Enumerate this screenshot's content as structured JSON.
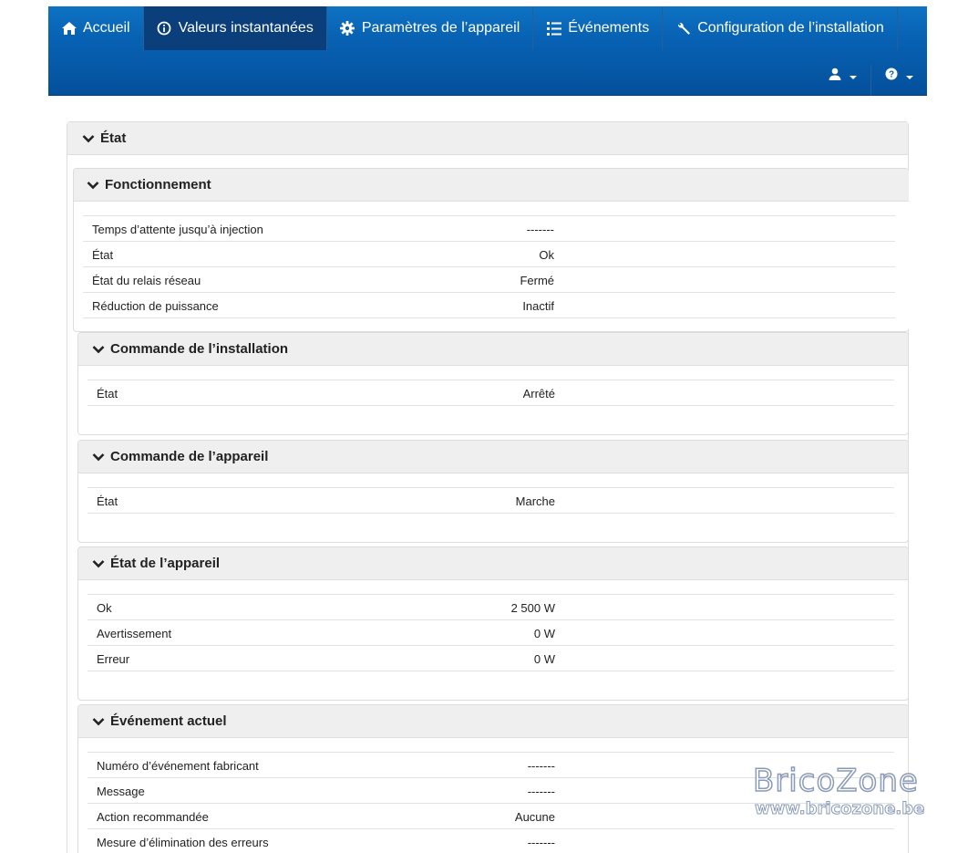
{
  "nav": {
    "items": [
      {
        "label": "Accueil",
        "icon": "home-icon"
      },
      {
        "label": "Valeurs instantanées",
        "icon": "info-icon"
      },
      {
        "label": "Paramètres de l’appareil",
        "icon": "gear-icon"
      },
      {
        "label": "Événements",
        "icon": "list-icon"
      },
      {
        "label": "Configuration de l’installation",
        "icon": "wrench-icon"
      }
    ],
    "active_index": 1,
    "right": [
      {
        "icon": "user-icon"
      },
      {
        "icon": "help-icon"
      }
    ]
  },
  "outer_panel": {
    "title": "État"
  },
  "panels": [
    {
      "title": "Fonctionnement",
      "rows": [
        {
          "label": "Temps d’attente jusqu’à injection",
          "value": "-------"
        },
        {
          "label": "État",
          "value": "Ok"
        },
        {
          "label": "État du relais réseau",
          "value": "Fermé"
        },
        {
          "label": "Réduction de puissance",
          "value": "Inactif"
        }
      ]
    },
    {
      "title": "Commande de l’installation",
      "rows": [
        {
          "label": "État",
          "value": "Arrêté"
        }
      ]
    },
    {
      "title": "Commande de l’appareil",
      "rows": [
        {
          "label": "État",
          "value": "Marche"
        }
      ]
    },
    {
      "title": "État de l’appareil",
      "rows": [
        {
          "label": "Ok",
          "value": "2 500 W"
        },
        {
          "label": "Avertissement",
          "value": "0 W"
        },
        {
          "label": "Erreur",
          "value": "0 W"
        }
      ]
    },
    {
      "title": "Événement actuel",
      "rows": [
        {
          "label": "Numéro d’événement fabricant",
          "value": "-------"
        },
        {
          "label": "Message",
          "value": "-------"
        },
        {
          "label": "Action recommandée",
          "value": "Aucune"
        },
        {
          "label": "Mesure d’élimination des erreurs",
          "value": "-------"
        }
      ]
    }
  ],
  "watermark": {
    "brand": "BricoZone",
    "url": "www.bricozone.be"
  }
}
